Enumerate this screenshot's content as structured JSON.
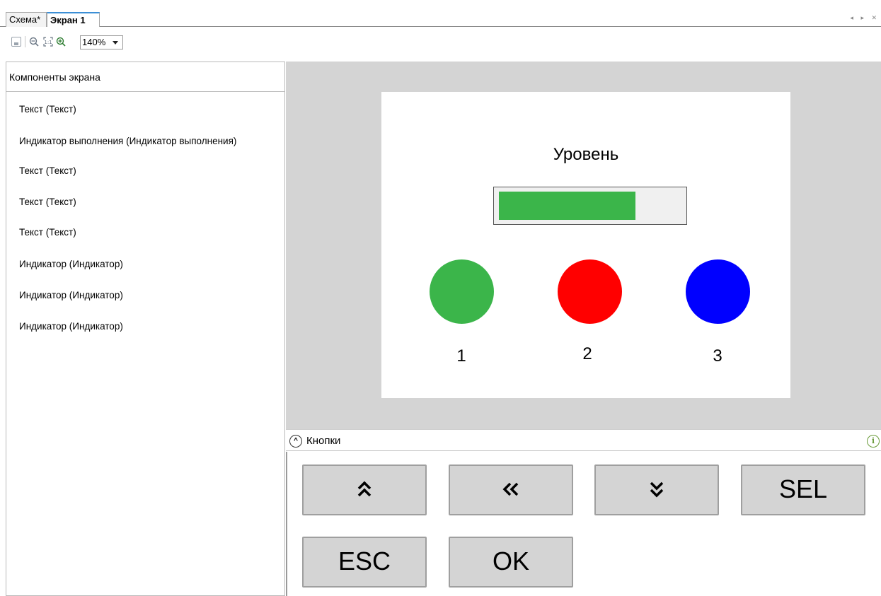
{
  "tabs": [
    {
      "label": "Схема*"
    },
    {
      "label": "Экран 1"
    }
  ],
  "tab_scroll_arrows": "◂ ▸ ✕",
  "toolbar": {
    "zoom_value": "140%",
    "icons": [
      "save-icon",
      "zoom-out-icon",
      "fit-icon",
      "zoom-in-icon"
    ]
  },
  "left_panel": {
    "title": "Компоненты экрана",
    "items": [
      "Текст  (Текст)",
      "Индикатор выполнения  (Индикатор выполнения)",
      "Текст  (Текст)",
      "Текст  (Текст)",
      "Текст  (Текст)",
      "Индикатор  (Индикатор)",
      "Индикатор  (Индикатор)",
      "Индикатор  (Индикатор)"
    ]
  },
  "screen": {
    "title": "Уровень",
    "progress_fraction": 0.75,
    "progress_color": "#3bb54a",
    "indicators": [
      {
        "label": "1",
        "color": "#3bb54a"
      },
      {
        "label": "2",
        "color": "#ff0000"
      },
      {
        "label": "3",
        "color": "#0000ff"
      }
    ]
  },
  "buttons_panel": {
    "title": "Кнопки",
    "buttons": [
      {
        "label": "≈",
        "name": "up-button",
        "icon": "double-chevron-up-icon",
        "glyph": "︽"
      },
      {
        "label": "«",
        "name": "left-button",
        "icon": "double-chevron-left-icon",
        "glyph": "«"
      },
      {
        "label": "≈",
        "name": "down-button",
        "icon": "double-chevron-down-icon",
        "glyph": "︾"
      },
      {
        "label": "SEL",
        "name": "sel-button"
      },
      {
        "label": "ESC",
        "name": "esc-button"
      },
      {
        "label": "OK",
        "name": "ok-button"
      }
    ]
  }
}
